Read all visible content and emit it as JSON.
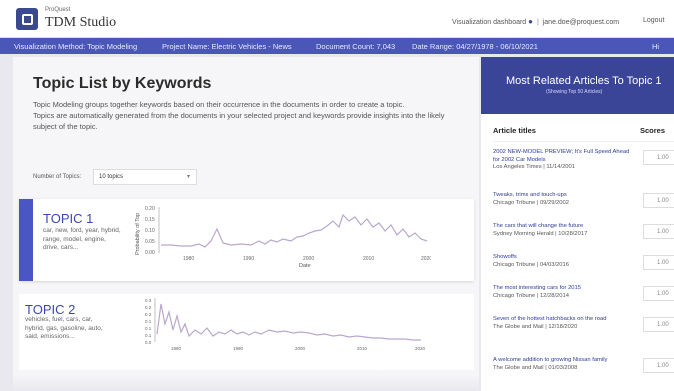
{
  "header": {
    "brand_small": "ProQuest",
    "brand": "TDM Studio",
    "dashboard_link": "Visualization dashboard",
    "user_email": "jane.doe@proquest.com",
    "logout": "Logout"
  },
  "infobar": {
    "method": "Visualization Method: Topic Modeling",
    "project": "Project Name: Electric Vehicles - News",
    "count": "Document Count: 7,043",
    "range": "Date Range: 04/27/1978 - 06/10/2021",
    "right": "Hi"
  },
  "main": {
    "title": "Topic List by Keywords",
    "desc1": "Topic Modeling groups together keywords based on their occurrence in the documents in order to create a topic.",
    "desc2": "Topics are automatically generated from the documents in your selected project and keywords provide insights into the likely subject of the topic.",
    "ntopics_label": "Number of Topics:",
    "ntopics_value": "10 topics"
  },
  "topics": [
    {
      "name": "TOPIC 1",
      "keywords": "car, new, ford, year, hybrid, range, model, engine, drive, cars...",
      "chart": {
        "ylabel": "Probability of Top",
        "xlabel": "Date",
        "yticks": [
          "0.20",
          "0.15",
          "0.10",
          "0.05",
          "0.00"
        ],
        "xticks": [
          "1980",
          "1990",
          "2000",
          "2010",
          "2020"
        ]
      }
    },
    {
      "name": "TOPIC 2",
      "keywords": "vehicles, fuel, cars, car, hybrid, gas, gasoline, auto, said, emissions...",
      "chart": {
        "yticks": [
          "0.3",
          "0.2",
          "0.2",
          "0.1",
          "0.1",
          "0.1",
          "0.0"
        ],
        "xticks": [
          "1980",
          "1990",
          "2000",
          "2010",
          "2020"
        ]
      }
    }
  ],
  "sidebar": {
    "title": "Most Related Articles To Topic 1",
    "subtitle": "(Showing Top 50 Articles)",
    "col_title": "Article titles",
    "col_score": "Scores",
    "articles": [
      {
        "title": "2002 NEW-MODEL PREVIEW; It's Full Speed Ahead for 2002 Car Models",
        "meta": "Los Angeles Times | 11/14/2001",
        "score": "1.00"
      },
      {
        "title": "Tweaks, trims and touch-ups",
        "meta": "Chicago Tribune | 09/29/2002",
        "score": "1.00"
      },
      {
        "title": "The cars that will change the future",
        "meta": "Sydney Morning Herald | 10/28/2017",
        "score": "1.00"
      },
      {
        "title": "Showoffs",
        "meta": "Chicago Tribune | 04/03/2016",
        "score": "1.00"
      },
      {
        "title": "The most interesting cars for 2015",
        "meta": "Chicago Tribune | 12/28/2014",
        "score": "1.00"
      },
      {
        "title": "Seven of the hottest hatchbacks on the road",
        "meta": "The Globe and Mail | 12/18/2020",
        "score": "1.00"
      },
      {
        "title": "A welcome addition to growing Nissan family",
        "meta": "The Globe and Mail | 01/03/2008",
        "score": "1.00"
      }
    ]
  }
}
